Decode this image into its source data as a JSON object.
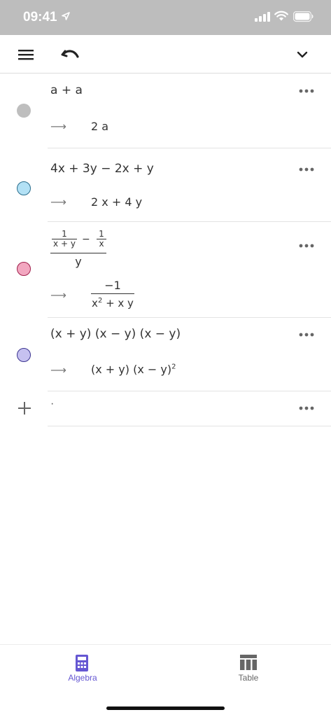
{
  "status_bar": {
    "time": "09:41"
  },
  "toolbar": {
    "menu_icon": "hamburger-menu-icon",
    "undo_icon": "undo-icon",
    "collapse_icon": "chevron-down-icon"
  },
  "algebra": {
    "rows": [
      {
        "input": "a + a",
        "output": "2 a",
        "color": "#bebebe"
      },
      {
        "input": "4x + 3y − 2x + y",
        "output": "2 x + 4 y",
        "color": "#b3e1f5"
      },
      {
        "input_fraction": {
          "term1_num": "1",
          "term1_den": "x + y",
          "operator": "−",
          "term2_num": "1",
          "term2_den": "x",
          "denominator": "y"
        },
        "output_fraction": {
          "num": "−1",
          "den_base": "x",
          "den_exp": "2",
          "den_rest": " + x y"
        },
        "color": "#f2a7c0"
      },
      {
        "input": "(x + y) (x − y) (x − y)",
        "output_base": "(x + y) (x − y)",
        "output_exp": "2",
        "color": "#c6c1f0"
      }
    ],
    "arrow": "⟶",
    "new_input_placeholder": "·"
  },
  "tabbar": {
    "tabs": [
      {
        "label": "Algebra",
        "active": true
      },
      {
        "label": "Table",
        "active": false
      }
    ]
  },
  "colors": {
    "accent": "#6557d2",
    "status_bar": "#bdbdbd"
  }
}
